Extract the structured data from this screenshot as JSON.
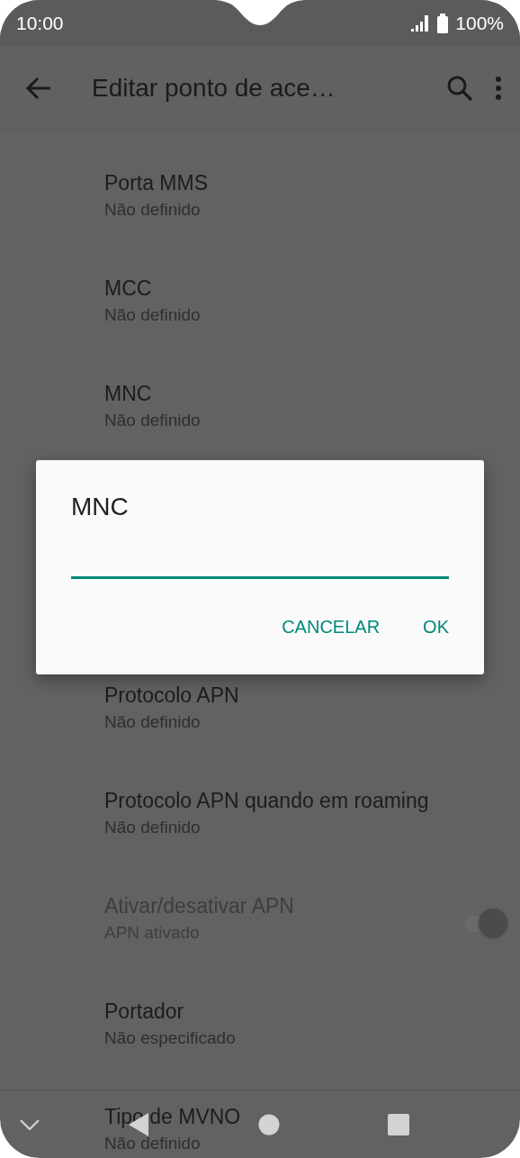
{
  "status_bar": {
    "time": "10:00",
    "battery": "100%"
  },
  "toolbar": {
    "title": "Editar ponto de ace…"
  },
  "settings": [
    {
      "kind": "text",
      "title": "Porta MMS",
      "summary": "Não definido",
      "disabled": false
    },
    {
      "kind": "text",
      "title": "MCC",
      "summary": "Não definido",
      "disabled": false
    },
    {
      "kind": "text",
      "title": "MNC",
      "summary": "Não definido",
      "disabled": false
    },
    {
      "kind": "text",
      "title": "Protocolo APN",
      "summary": "Não definido",
      "disabled": false
    },
    {
      "kind": "text",
      "title": "Protocolo APN quando em roaming",
      "summary": "Não definido",
      "disabled": false
    },
    {
      "kind": "switch",
      "title": "Ativar/desativar APN",
      "summary": "APN ativado",
      "disabled": true,
      "on": true
    },
    {
      "kind": "text",
      "title": "Portador",
      "summary": "Não especificado",
      "disabled": false
    },
    {
      "kind": "text",
      "title": "Tipo de MVNO",
      "summary": "Não definido",
      "disabled": false
    }
  ],
  "dialog": {
    "title": "MNC",
    "buttons": [
      "CANCELAR",
      "OK"
    ]
  }
}
